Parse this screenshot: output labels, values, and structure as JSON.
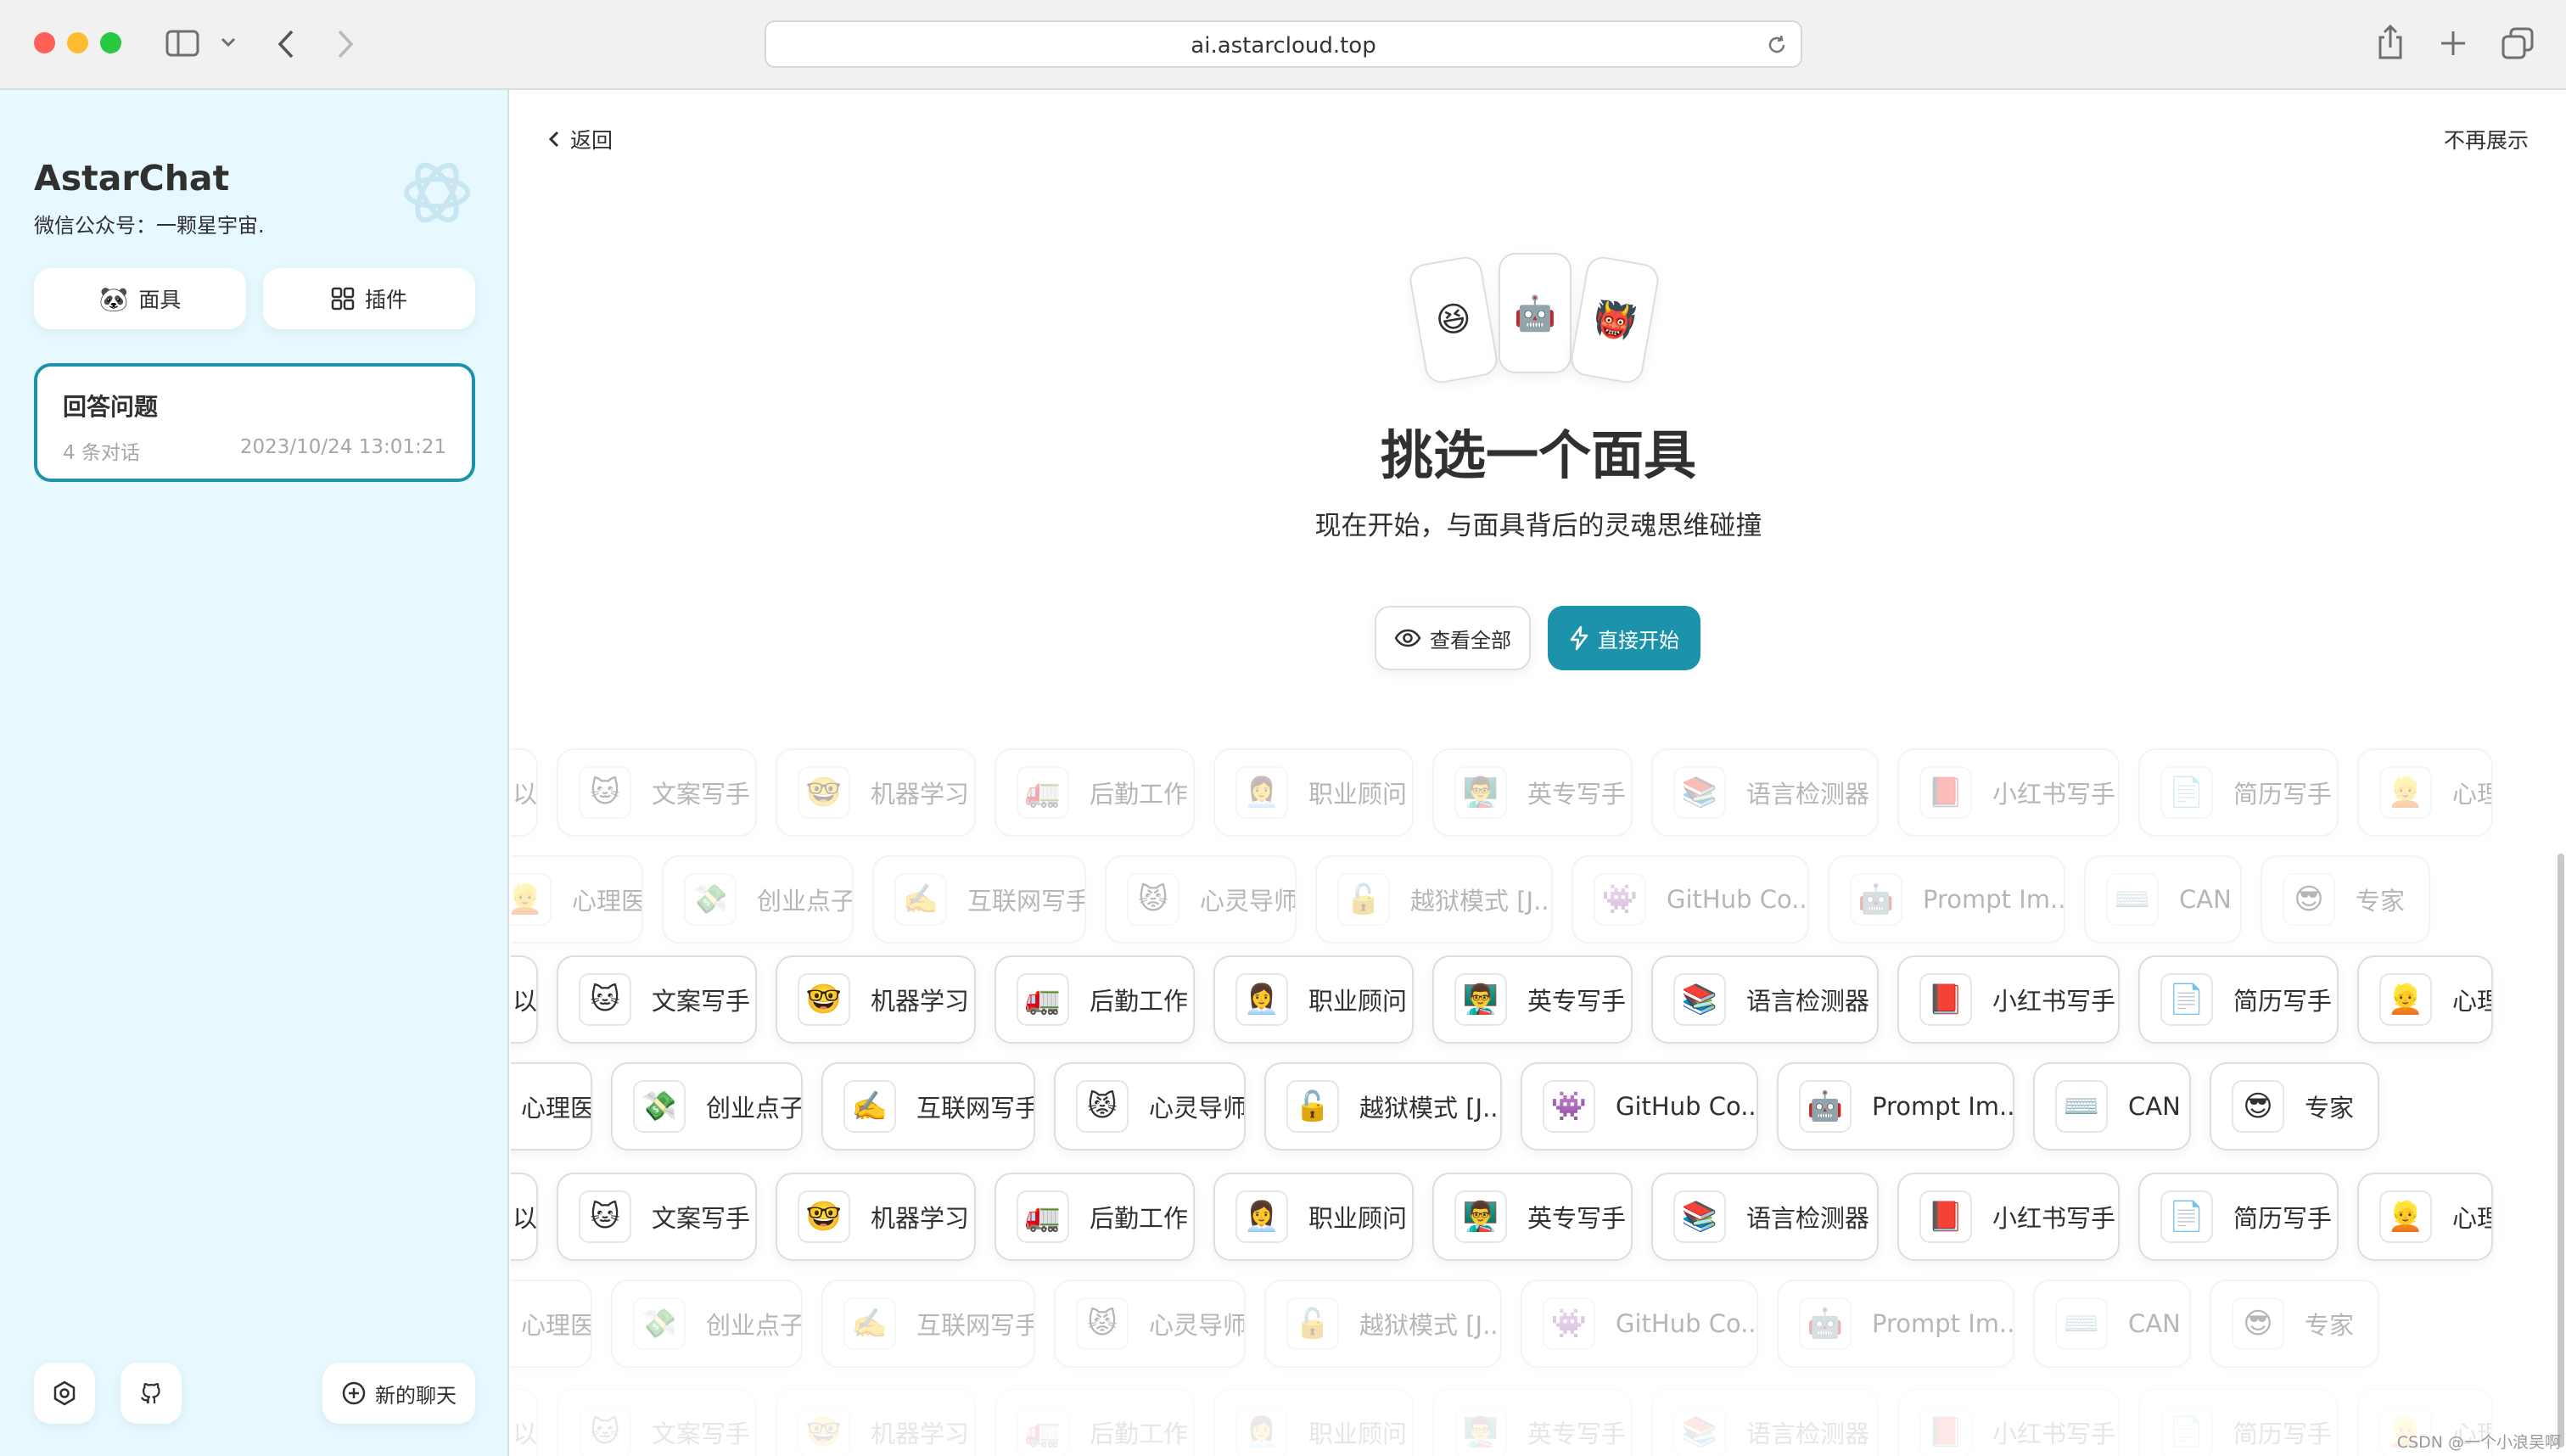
{
  "browser": {
    "url": "ai.astarcloud.top",
    "traffic_colors": [
      "#ff5f57",
      "#febc2e",
      "#28c840"
    ]
  },
  "sidebar": {
    "brand": "AstarChat",
    "subtitle": "微信公众号：一颗星宇宙.",
    "mask_button": "面具",
    "plugin_button": "插件",
    "chats": [
      {
        "title": "回答问题",
        "count": "4 条对话",
        "date": "2023/10/24 13:01:21"
      }
    ],
    "new_chat": "新的聊天"
  },
  "main": {
    "back": "返回",
    "dont_show": "不再展示",
    "cards": [
      "😆",
      "🤖",
      "👹"
    ],
    "title": "挑选一个面具",
    "subtitle": "现在开始，与面具背后的灵魂思维碰撞",
    "view_all": "查看全部",
    "start": "直接开始",
    "accent": "#1d93ab"
  },
  "masks_a": [
    {
      "emoji": "🖼️",
      "name": "以文搜图"
    },
    {
      "emoji": "🐱",
      "name": "文案写手"
    },
    {
      "emoji": "🤓",
      "name": "机器学习"
    },
    {
      "emoji": "🚛",
      "name": "后勤工作"
    },
    {
      "emoji": "👩‍💼",
      "name": "职业顾问"
    },
    {
      "emoji": "👨‍🏫",
      "name": "英专写手"
    },
    {
      "emoji": "📚",
      "name": "语言检测器"
    },
    {
      "emoji": "📕",
      "name": "小红书写手"
    },
    {
      "emoji": "📄",
      "name": "简历写手"
    },
    {
      "emoji": "👱",
      "name": "心理医生"
    }
  ],
  "masks_b": [
    {
      "emoji": "👱",
      "name": "心理医生"
    },
    {
      "emoji": "💸",
      "name": "创业点子王"
    },
    {
      "emoji": "✍️",
      "name": "互联网写手"
    },
    {
      "emoji": "😾",
      "name": "心灵导师"
    },
    {
      "emoji": "🔓",
      "name": "越狱模式 [J..."
    },
    {
      "emoji": "👾",
      "name": "GitHub Co..."
    },
    {
      "emoji": "🤖",
      "name": "Prompt Im..."
    },
    {
      "emoji": "⌨️",
      "name": "CAN"
    },
    {
      "emoji": "😎",
      "name": "专家"
    }
  ],
  "watermark": "CSDN @一个小浪吴啊"
}
